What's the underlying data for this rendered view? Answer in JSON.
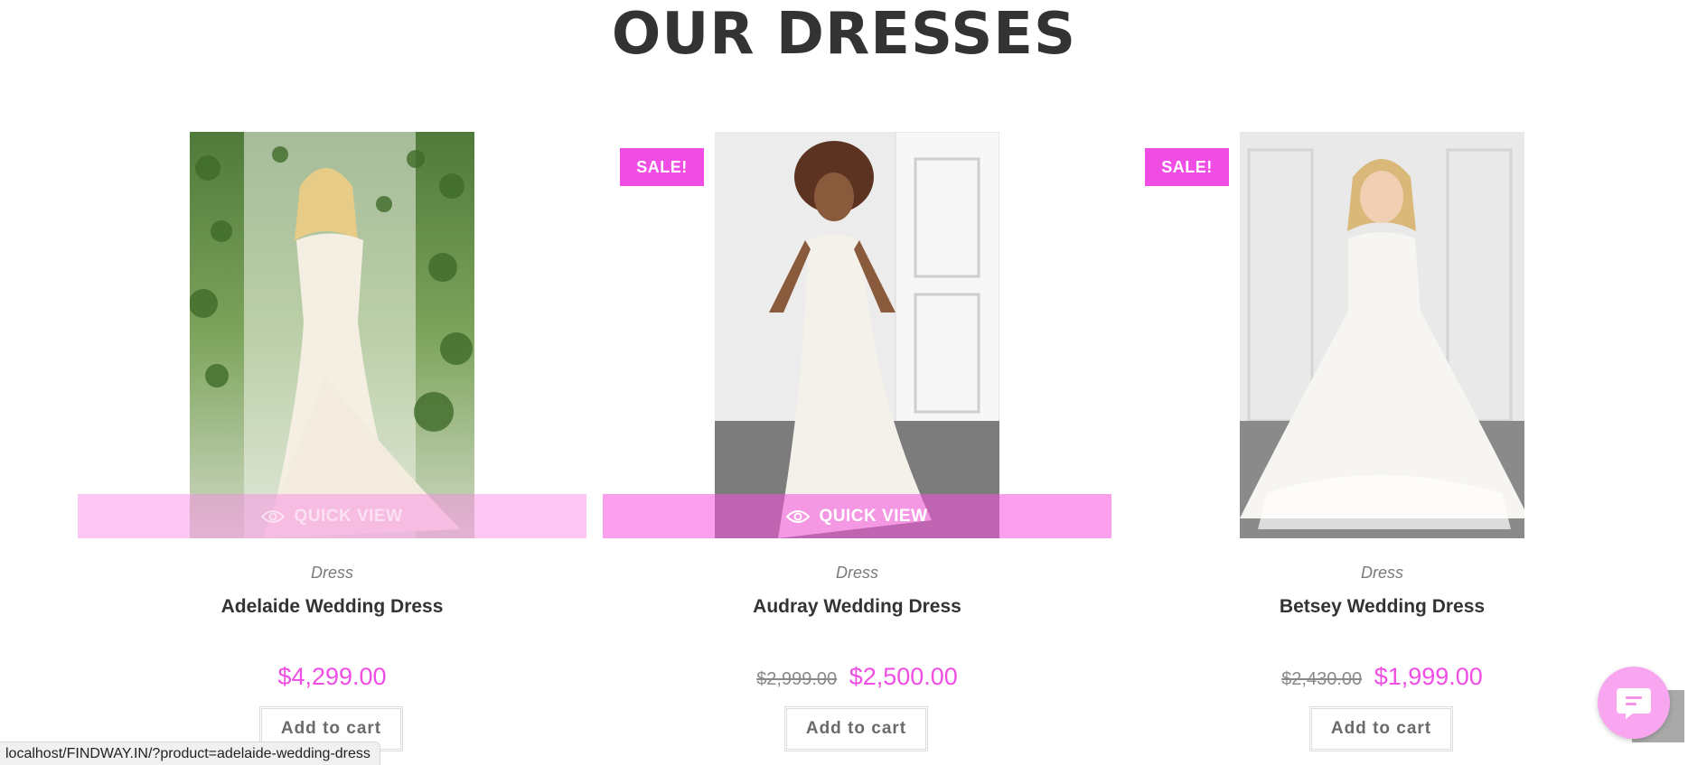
{
  "section": {
    "title": "OUR DRESSES"
  },
  "products": [
    {
      "quick_view": "QUICK VIEW",
      "category": "Dress",
      "name": "Adelaide Wedding Dress",
      "price": "$4,299.00",
      "add_to_cart": "Add to cart"
    },
    {
      "sale_badge": "SALE!",
      "quick_view": "QUICK VIEW",
      "category": "Dress",
      "name": "Audray Wedding Dress",
      "old_price": "$2,999.00",
      "price": "$2,500.00",
      "add_to_cart": "Add to cart"
    },
    {
      "sale_badge": "SALE!",
      "category": "Dress",
      "name": "Betsey Wedding Dress",
      "old_price": "$2,430.00",
      "price": "$1,999.00",
      "add_to_cart": "Add to cart"
    }
  ],
  "status_bar": {
    "url": "localhost/FINDWAY.IN/?product=adelaide-wedding-dress"
  },
  "icons": {
    "quick_view": "eye-icon",
    "chat": "chat-icon",
    "scroll_top": "scroll-to-top-icon"
  },
  "colors": {
    "accent": "#f04de4",
    "quick_view_overlay": "#f550dc",
    "title": "#333333"
  }
}
